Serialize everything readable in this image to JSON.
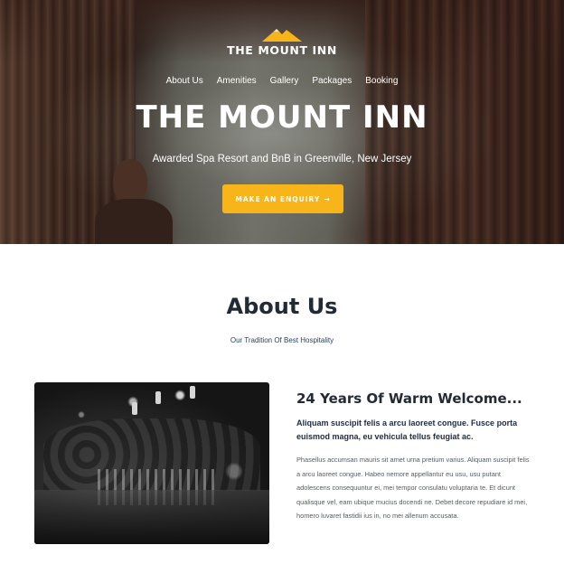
{
  "brand": {
    "name": "THE MOUNT INN",
    "accent_color": "#f7b51a",
    "logo_icon": "mountain-icon"
  },
  "nav": {
    "items": [
      "About Us",
      "Amenities",
      "Gallery",
      "Packages",
      "Booking"
    ]
  },
  "hero": {
    "title": "THE MOUNT INN",
    "subtitle": "Awarded Spa Resort and BnB in Greenville, New Jersey",
    "cta_label": "MAKE AN ENQUIRY",
    "cta_icon": "arrow-right-icon"
  },
  "about": {
    "heading": "About Us",
    "tagline": "Our Tradition Of Best Hospitality",
    "welcome_title": "24 Years Of Warm Welcome...",
    "lead": "Aliquam suscipit felis a arcu laoreet congue. Fusce porta euismod magna, eu vehicula tellus feugiat ac.",
    "body": "Phasellus accumsan mauris sit amet urna pretium varius. Aliquam suscipit felis a arcu laoreet congue. Habeo nemore appellantur eu usu, usu putant adolescens consequuntur ei, mei tempor consulatu voluptaria te. Et dicunt qualisque vel, eam ubique mucius docendi ne. Debet decore repudiare id mei, homero luvaret fastidii ius in, no mei allenum accusata."
  }
}
